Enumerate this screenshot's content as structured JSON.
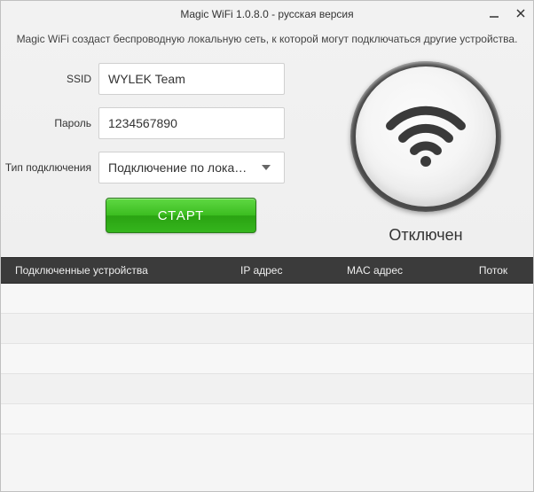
{
  "window": {
    "title": "Magic WiFi  1.0.8.0 - русская версия"
  },
  "description": "Magic WiFi создаст беспроводную локальную сеть, к которой могут подключаться другие устройства.",
  "form": {
    "ssid_label": "SSID",
    "ssid_value": "WYLEK Team",
    "password_label": "Пароль",
    "password_value": "1234567890",
    "conn_label": "Тип подключения",
    "conn_value": "Подключение по локал..."
  },
  "start_label": "СТАРТ",
  "status_text": "Отключен",
  "table": {
    "col_devices": "Подключенные устройства",
    "col_ip": "IP адрес",
    "col_mac": "MAC адрес",
    "col_stream": "Поток"
  }
}
